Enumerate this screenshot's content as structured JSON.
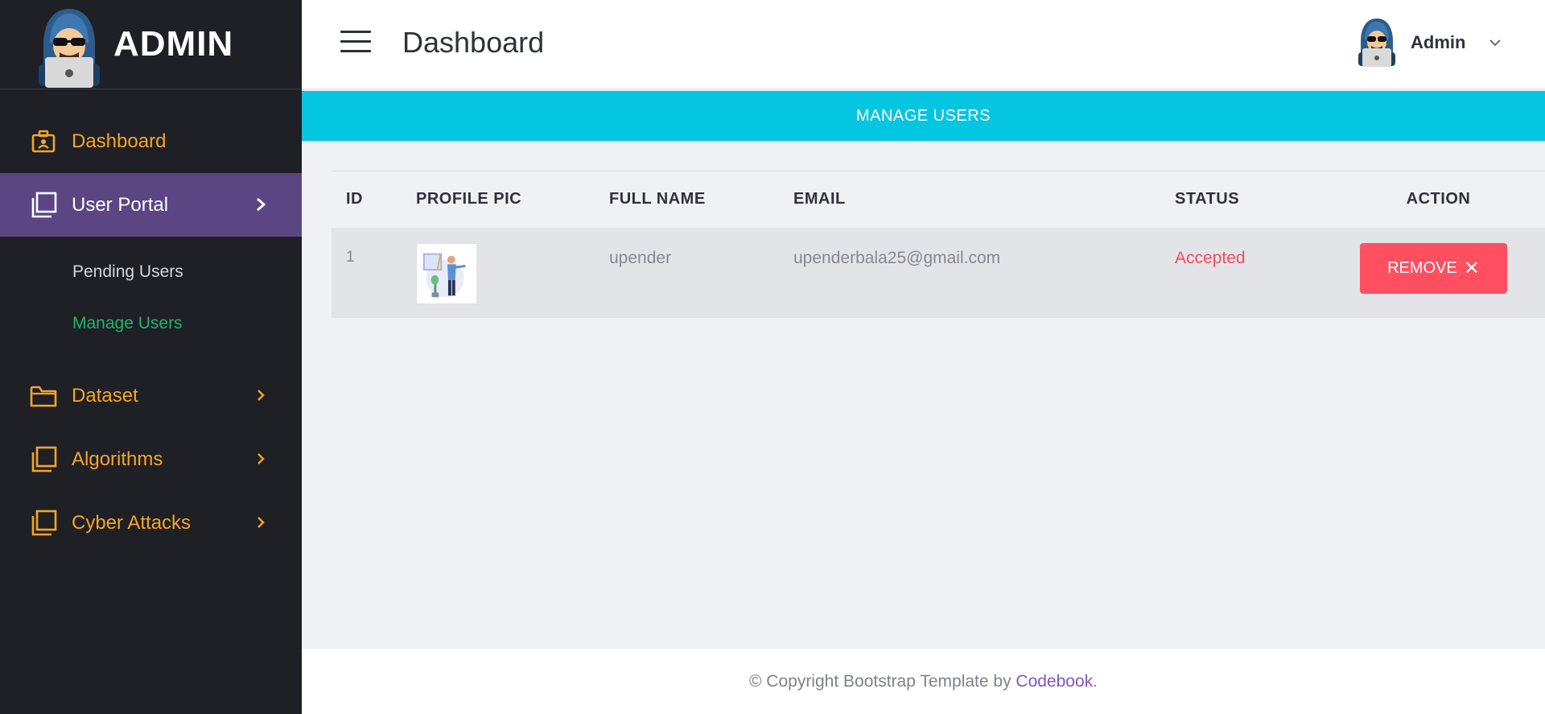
{
  "brand": {
    "title": "ADMIN"
  },
  "sidebar": {
    "items": [
      {
        "label": "Dashboard",
        "icon": "briefcase-icon"
      },
      {
        "label": "User Portal",
        "icon": "copy-icon"
      },
      {
        "label": "Dataset",
        "icon": "folder-icon"
      },
      {
        "label": "Algorithms",
        "icon": "copy-icon"
      },
      {
        "label": "Cyber Attacks",
        "icon": "copy-icon"
      }
    ],
    "submenu": [
      {
        "label": "Pending Users"
      },
      {
        "label": "Manage Users"
      }
    ]
  },
  "header": {
    "title": "Dashboard",
    "user_name": "Admin"
  },
  "banner": {
    "label": "MANAGE USERS"
  },
  "table": {
    "headers": [
      "ID",
      "PROFILE PIC",
      "FULL NAME",
      "EMAIL",
      "STATUS",
      "ACTION"
    ],
    "rows": [
      {
        "id": "1",
        "full_name": "upender",
        "email": "upenderbala25@gmail.com",
        "status": "Accepted",
        "action": "REMOVE"
      }
    ]
  },
  "footer": {
    "prefix": "© Copyright Bootstrap Template by ",
    "link": "Codebook",
    "suffix": "."
  },
  "colors": {
    "sidebar_bg": "#1f1f26",
    "active_item": "#5b4683",
    "accent_orange": "#f5a623",
    "banner": "#04c6e0",
    "remove_button": "#ff4f61",
    "status_accepted": "#f44b5c",
    "submenu_active": "#23b46b"
  }
}
